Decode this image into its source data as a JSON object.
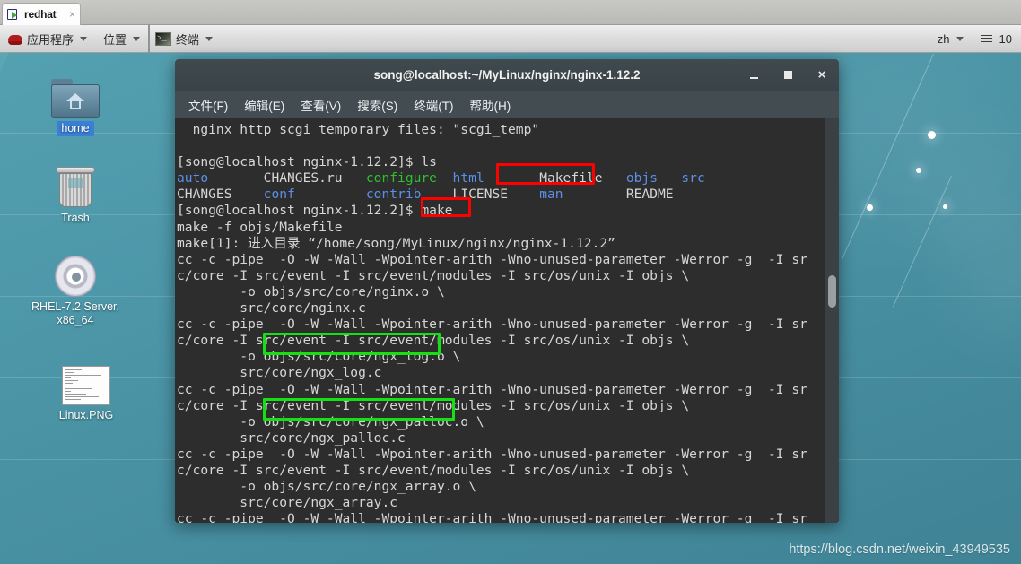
{
  "tabstrip": {
    "tab_label": "redhat",
    "close_label": "×",
    "icon": "redhat-shadowman-icon"
  },
  "panel": {
    "applications": "应用程序",
    "places": "位置",
    "window_selector": "终端",
    "terminal_prompt_glyph": ">_",
    "lang": "zh",
    "clock": "10"
  },
  "terminal": {
    "title": "song@localhost:~/MyLinux/nginx/nginx-1.12.2",
    "menus": [
      "文件(F)",
      "编辑(E)",
      "查看(V)",
      "搜索(S)",
      "终端(T)",
      "帮助(H)"
    ],
    "window_buttons": {
      "minimize": "minimize",
      "maximize": "maximize",
      "close": "×"
    },
    "prompt": "[song@localhost nginx-1.12.2]$ ",
    "lines": [
      {
        "id": "l1",
        "text": "  nginx http scgi temporary files: \"scgi_temp\""
      },
      {
        "id": "l2",
        "text": ""
      },
      {
        "id": "l3",
        "text": "[song@localhost nginx-1.12.2]$ ls"
      },
      {
        "id": "l4",
        "type": "ls-row-1"
      },
      {
        "id": "l5",
        "type": "ls-row-2"
      },
      {
        "id": "l6",
        "text": "[song@localhost nginx-1.12.2]$ make"
      },
      {
        "id": "l7",
        "text": "make -f objs/Makefile"
      },
      {
        "id": "l8",
        "text": "make[1]: 进入目录 “/home/song/MyLinux/nginx/nginx-1.12.2”"
      },
      {
        "id": "l9",
        "text": "cc -c -pipe  -O -W -Wall -Wpointer-arith -Wno-unused-parameter -Werror -g  -I sr"
      },
      {
        "id": "l10",
        "text": "c/core -I src/event -I src/event/modules -I src/os/unix -I objs \\"
      },
      {
        "id": "l11",
        "text": "        -o objs/src/core/nginx.o \\"
      },
      {
        "id": "l12",
        "text": "        src/core/nginx.c"
      },
      {
        "id": "l13",
        "text": "cc -c -pipe  -O -W -Wall -Wpointer-arith -Wno-unused-parameter -Werror -g  -I sr"
      },
      {
        "id": "l14",
        "text": "c/core -I src/event -I src/event/modules -I src/os/unix -I objs \\"
      },
      {
        "id": "l15",
        "text": "        -o objs/src/core/ngx_log.o \\"
      },
      {
        "id": "l16",
        "text": "        src/core/ngx_log.c"
      },
      {
        "id": "l17",
        "text": "cc -c -pipe  -O -W -Wall -Wpointer-arith -Wno-unused-parameter -Werror -g  -I sr"
      },
      {
        "id": "l18",
        "text": "c/core -I src/event -I src/event/modules -I src/os/unix -I objs \\"
      },
      {
        "id": "l19",
        "text": "        -o objs/src/core/ngx_palloc.o \\"
      },
      {
        "id": "l20",
        "text": "        src/core/ngx_palloc.c"
      },
      {
        "id": "l21",
        "text": "cc -c -pipe  -O -W -Wall -Wpointer-arith -Wno-unused-parameter -Werror -g  -I sr"
      },
      {
        "id": "l22",
        "text": "c/core -I src/event -I src/event/modules -I src/os/unix -I objs \\"
      },
      {
        "id": "l23",
        "text": "        -o objs/src/core/ngx_array.o \\"
      },
      {
        "id": "l24",
        "text": "        src/core/ngx_array.c"
      },
      {
        "id": "l25",
        "text": "cc -c -pipe  -O -W -Wall -Wpointer-arith -Wno-unused-parameter -Werror -g  -I sr"
      }
    ],
    "ls_output": {
      "row1": [
        {
          "name": "auto",
          "color": "blue",
          "pad": 11
        },
        {
          "name": "CHANGES.ru",
          "color": "white",
          "pad": 13
        },
        {
          "name": "configure",
          "color": "green",
          "pad": 11
        },
        {
          "name": "html",
          "color": "blue",
          "pad": 11
        },
        {
          "name": "Makefile",
          "color": "white",
          "pad": 11
        },
        {
          "name": "objs",
          "color": "blue",
          "pad": 7
        },
        {
          "name": "src",
          "color": "blue",
          "pad": 3
        }
      ],
      "row2": [
        {
          "name": "CHANGES",
          "color": "white",
          "pad": 11
        },
        {
          "name": "conf",
          "color": "blue",
          "pad": 13
        },
        {
          "name": "contrib",
          "color": "blue",
          "pad": 11
        },
        {
          "name": "LICENSE",
          "color": "white",
          "pad": 11
        },
        {
          "name": "man",
          "color": "blue",
          "pad": 11
        },
        {
          "name": "README",
          "color": "white",
          "pad": 7
        }
      ]
    },
    "colors": {
      "background": "#2d2d2d",
      "foreground": "#d6d6d6",
      "directory_blue": "#5c8fe6",
      "executable_green": "#2fbf2f",
      "titlebar": "#3d4649"
    }
  },
  "annotations": [
    {
      "name": "Makefile",
      "color": "#ff0000"
    },
    {
      "name": "make",
      "color": "#ff0000"
    },
    {
      "name": "objs/src/core/nginx.o",
      "color": "#14e014"
    },
    {
      "name": "objs/src/core/ngx_log.o",
      "color": "#14e014"
    }
  ],
  "desktop": {
    "icons": [
      {
        "label": "home",
        "glyph": "home-folder-icon",
        "selected": true
      },
      {
        "label": "Trash",
        "glyph": "trash-icon",
        "selected": false
      },
      {
        "label": "RHEL-7.2 Server.\nx86_64",
        "glyph": "cd-disc-icon",
        "selected": false
      },
      {
        "label": "Linux.PNG",
        "glyph": "image-file-icon",
        "selected": false
      }
    ],
    "background_color": "#4a94a6"
  },
  "watermark": "https://blog.csdn.net/weixin_43949535"
}
